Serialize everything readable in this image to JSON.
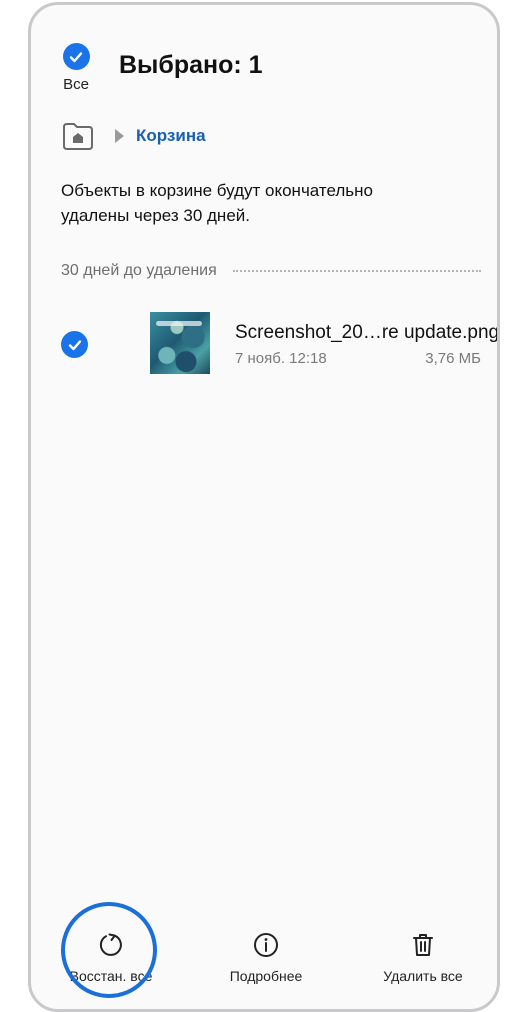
{
  "header": {
    "select_all_label": "Все",
    "title": "Выбрано: 1"
  },
  "breadcrumb": {
    "home_icon": "home-folder-icon",
    "current": "Корзина"
  },
  "info_text": "Объекты в корзине будут окончательно удалены через 30 дней.",
  "section": {
    "label": "30 дней до удаления"
  },
  "files": [
    {
      "name": "Screenshot_20…re update.png",
      "date": "7 нояб. 12:18",
      "size": "3,76 МБ",
      "selected": true
    }
  ],
  "actions": {
    "restore_label": "Восстан. все",
    "details_label": "Подробнее",
    "delete_label": "Удалить все"
  },
  "colors": {
    "accent": "#1a73e8",
    "link": "#1a5fb4",
    "highlight": "#1a6fd8"
  }
}
